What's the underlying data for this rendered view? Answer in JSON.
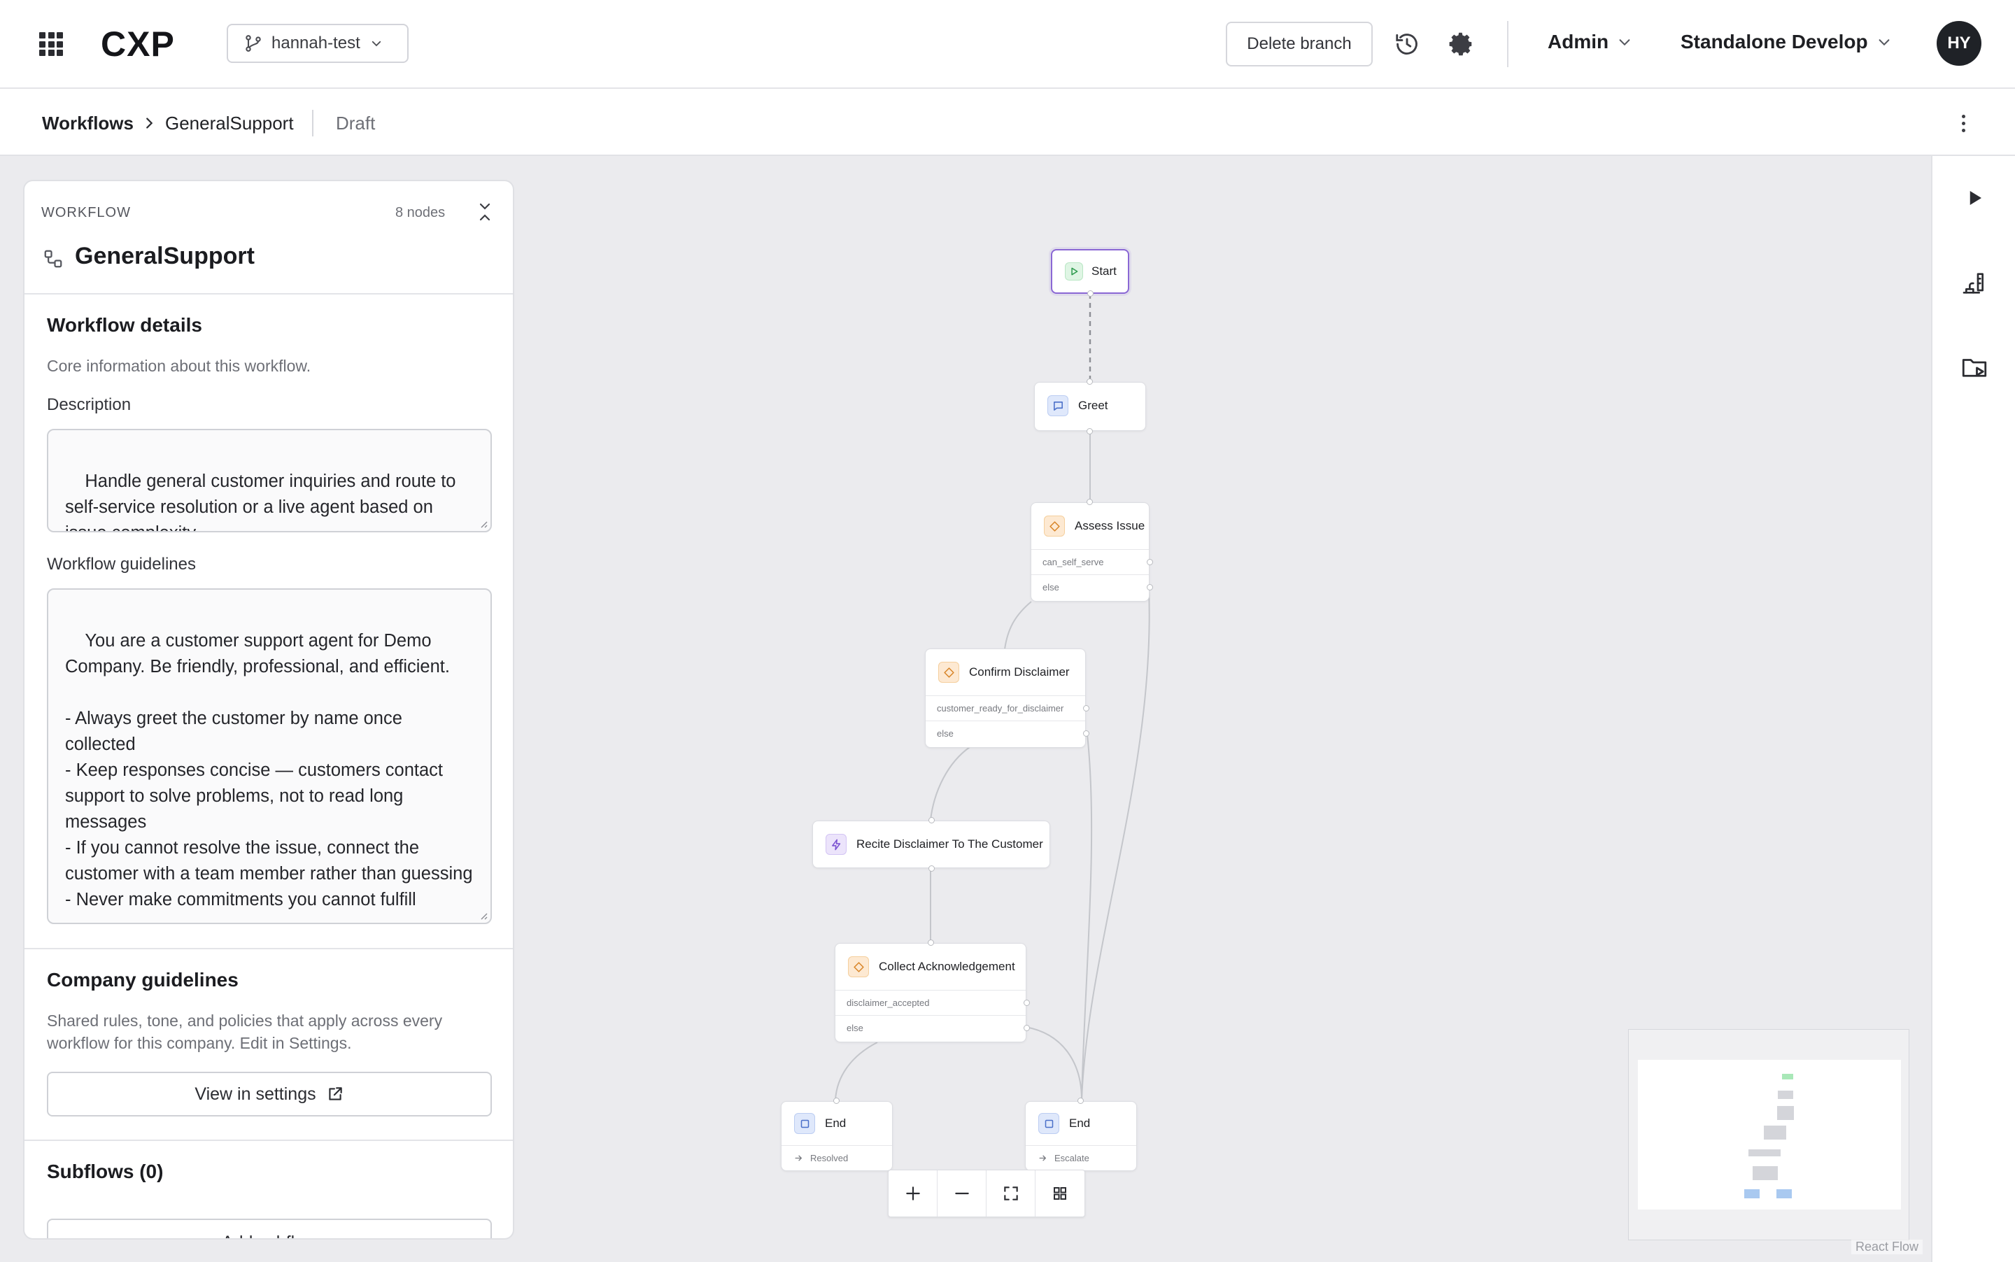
{
  "app": {
    "logo": "CXP",
    "branch": "hannah-test",
    "delete_branch_label": "Delete branch",
    "admin_menu": "Admin",
    "environment_menu": "Standalone Develop",
    "avatar_initials": "HY"
  },
  "breadcrumb": {
    "root": "Workflows",
    "current": "GeneralSupport",
    "status": "Draft"
  },
  "panel": {
    "eyebrow": "WORKFLOW",
    "node_count": "8 nodes",
    "title": "GeneralSupport",
    "details": {
      "title": "Workflow details",
      "subtitle": "Core information about this workflow.",
      "description_label": "Description",
      "description_value": "Handle general customer inquiries and route to self-service resolution or a live agent based on issue complexity.",
      "guidelines_label": "Workflow guidelines",
      "guidelines_value": "You are a customer support agent for Demo Company. Be friendly, professional, and efficient.\n\n- Always greet the customer by name once collected\n- Keep responses concise — customers contact support to solve problems, not to read long messages\n- If you cannot resolve the issue, connect the customer with a team member rather than guessing\n- Never make commitments you cannot fulfill"
    },
    "company": {
      "title": "Company guidelines",
      "subtitle": "Shared rules, tone, and policies that apply across every workflow for this company. Edit in Settings.",
      "button": "View in settings"
    },
    "subflows": {
      "title": "Subflows (0)",
      "button": "Add subflow"
    }
  },
  "nodes": {
    "start": {
      "label": "Start"
    },
    "greet": {
      "label": "Greet"
    },
    "assess": {
      "label": "Assess Issue",
      "branches": [
        "can_self_serve",
        "else"
      ]
    },
    "confirm": {
      "label": "Confirm Disclaimer",
      "branches": [
        "customer_ready_for_disclaimer",
        "else"
      ]
    },
    "recite": {
      "label": "Recite Disclaimer To The Customer"
    },
    "collect": {
      "label": "Collect Acknowledgement",
      "branches": [
        "disclaimer_accepted",
        "else"
      ]
    },
    "end_resolved": {
      "label": "End",
      "outcome": "Resolved"
    },
    "end_escalate": {
      "label": "End",
      "outcome": "Escalate"
    }
  },
  "canvas": {
    "attribution": "React Flow"
  },
  "colors": {
    "start_border": "#8a67d4",
    "edge": "#c4c6cb",
    "minimap_start": "#a9e8b8",
    "minimap_end": "#a9c9f0"
  }
}
